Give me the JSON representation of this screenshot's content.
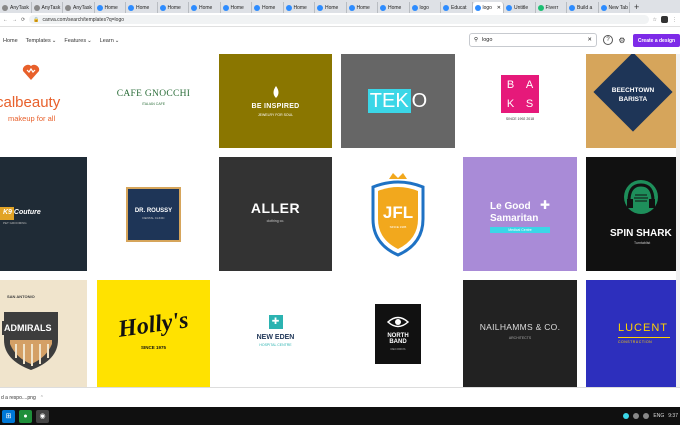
{
  "tabs": [
    {
      "label": "AnyTask"
    },
    {
      "label": "AnyTask"
    },
    {
      "label": "AnyTask"
    },
    {
      "label": "Home"
    },
    {
      "label": "Home"
    },
    {
      "label": "Home"
    },
    {
      "label": "Home"
    },
    {
      "label": "Home"
    },
    {
      "label": "Home"
    },
    {
      "label": "Home"
    },
    {
      "label": "Home"
    },
    {
      "label": "Home"
    },
    {
      "label": "Home"
    },
    {
      "label": "logo"
    },
    {
      "label": "Educat"
    },
    {
      "label": "logo"
    },
    {
      "label": "Untitle"
    },
    {
      "label": "Fiverr"
    },
    {
      "label": "Build a"
    },
    {
      "label": "New Tab"
    }
  ],
  "address": {
    "url": "canva.com/search/templates?q=logo"
  },
  "nav": {
    "home": "Home",
    "templates": "Templates",
    "features": "Features",
    "learn": "Learn"
  },
  "search": {
    "query": "logo"
  },
  "header": {
    "create_label": "Create a design"
  },
  "icons": {
    "help": "?",
    "settings": "⚙"
  },
  "logos": {
    "l1": {
      "name": "calbeauty",
      "tag": "makeup for all"
    },
    "l2": {
      "name": "CAFE GNOCCHI",
      "sub": "ITALIAN CAFE"
    },
    "l3": {
      "name": "BE INSPIRED",
      "sub": "JEWELRY FOR SOUL"
    },
    "l4": {
      "name1": "TEK",
      "name2": "O"
    },
    "l5": {
      "letters": [
        "B",
        "A",
        "K",
        "S"
      ],
      "sub": "SINCE 1992 2018"
    },
    "l6": {
      "line1": "BEECHTOWN",
      "line2": "BARISTA"
    },
    "l7": {
      "name": "K9 Couture",
      "sub": "PET GROOMING"
    },
    "l8": {
      "name": "DR. ROUSSY",
      "sub": "DENTAL CLINIC"
    },
    "l9": {
      "name": "ALLER",
      "sub": "clothing co."
    },
    "l10": {
      "name": "JFL",
      "sub": "SINCE 1995"
    },
    "l11": {
      "line1": "Le Good",
      "line2": "Samaritan",
      "sub": "Medical Centre"
    },
    "l12": {
      "name": "SPIN SHARK",
      "sub": "Turntablist"
    },
    "l13": {
      "top": "SAN ANTONIO",
      "name": "ADMIRALS"
    },
    "l14": {
      "name": "Holly's",
      "sub": "SINCE 1975"
    },
    "l15": {
      "name": "NEW EDEN",
      "sub": "HOSPITAL CENTRE"
    },
    "l16": {
      "line1": "NORTH",
      "line2": "BAND",
      "sub": "RECORDS"
    },
    "l17": {
      "name": "NAILHAMMS & CO.",
      "sub": "ARCHITECTS"
    },
    "l18": {
      "name": "LUCENT",
      "sub": "CONSTRUCTION"
    }
  },
  "download": {
    "file": "d a respo....png"
  },
  "taskbar": {
    "lang": "ENG",
    "time": "9:37"
  },
  "colors": {
    "accent": "#7d2ae8",
    "beauty_orange": "#e8602b",
    "olive": "#8a7600",
    "teko_cyan": "#3bd6e7",
    "baks_pink": "#e6197a",
    "gold": "#d6a55b",
    "navy": "#1e3557",
    "k9_dark": "#1f2b36",
    "lavender": "#a98bd7",
    "holly_yellow": "#ffe200",
    "lucent_blue": "#2d2fbd"
  }
}
